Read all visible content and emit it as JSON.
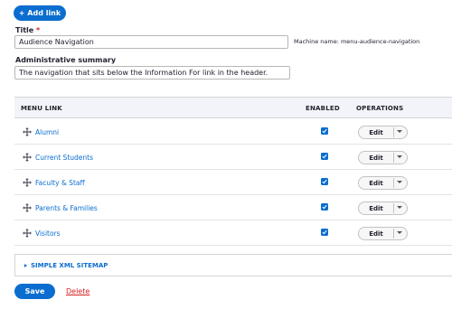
{
  "add_link_label": "+ Add link",
  "title_field": {
    "label": "Title",
    "required_mark": "*",
    "value": "Audience Navigation"
  },
  "machine_name": "Machine name: menu-audience-navigation",
  "summary_field": {
    "label": "Administrative summary",
    "value": "The navigation that sits below the Information For link in the header."
  },
  "table": {
    "headers": {
      "menu_link": "MENU LINK",
      "enabled": "ENABLED",
      "operations": "OPERATIONS"
    },
    "rows": [
      {
        "label": "Alumni",
        "enabled": true,
        "op": "Edit"
      },
      {
        "label": "Current Students",
        "enabled": true,
        "op": "Edit"
      },
      {
        "label": "Faculty & Staff",
        "enabled": true,
        "op": "Edit"
      },
      {
        "label": "Parents & Families",
        "enabled": true,
        "op": "Edit"
      },
      {
        "label": "Visitors",
        "enabled": true,
        "op": "Edit"
      }
    ]
  },
  "details_title": "SIMPLE XML SITEMAP",
  "save_label": "Save",
  "delete_label": "Delete",
  "colors": {
    "primary": "#0b6dcf",
    "danger": "#d72222",
    "header_bg": "#f3f4f9"
  },
  "icons": {
    "drag": "move-arrows-icon",
    "check": "checkmark-icon",
    "dropdown": "triangle-down-icon",
    "expand": "triangle-right-icon"
  }
}
